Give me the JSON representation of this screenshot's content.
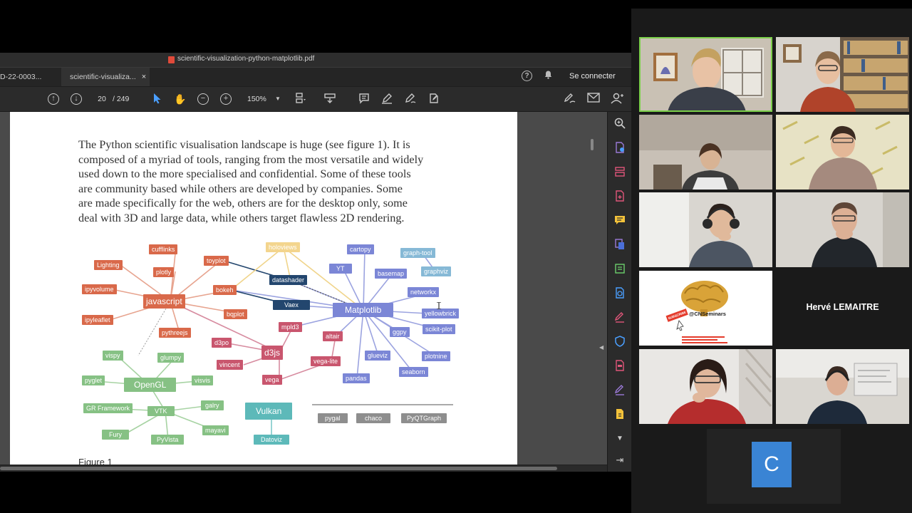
{
  "acrobat": {
    "window_title": "scientific-visualization-python-matplotlib.pdf",
    "tabs": [
      {
        "label": "D-22-0003..."
      },
      {
        "label": "scientific-visualiza..."
      }
    ],
    "connect_label": "Se connecter",
    "page_current": "20",
    "page_total": "/ 249",
    "zoom_level": "150%"
  },
  "document": {
    "paragraph_lines": [
      "The Python scientific visualisation landscape is huge (see figure 1).  It is",
      "composed of a myriad of tools, ranging from the most versatile and widely",
      "used down to the more specialised and confidential. Some of these tools",
      "are community based while others are developed by companies.  Some",
      "are made specifically for the web, others are for the desktop only, some",
      "deal with 3D and large data, while others target flawless 2D rendering."
    ],
    "figure_caption": "Figure 1",
    "graph_nodes": {
      "matplotlib": "Matplotlib",
      "javascript": "javascript",
      "d3js": "d3js",
      "opengl": "OpenGL",
      "vulkan": "Vulkan",
      "cufflinks": "cufflinks",
      "toyplot": "toyplot",
      "lighting": "Lighting",
      "plotly": "plotly",
      "ipyvolume": "ipyvolume",
      "bokeh": "bokeh",
      "ipyleaflet": "ipyleaflet",
      "bqplot": "bqplot",
      "pythreejs": "pythreejs",
      "d3po": "d3po",
      "mpld3": "mpld3",
      "vincent": "vincent",
      "vega": "vega",
      "vegalite": "vega-lite",
      "altair": "altair",
      "holoviews": "holoviews",
      "datashader": "datashader",
      "vaex": "Vaex",
      "cartopy": "cartopy",
      "yt": "YT",
      "basemap": "basemap",
      "graphtool": "graph-tool",
      "graphviz": "graphviz",
      "networkx": "networkx",
      "yellowbrick": "yellowbrick",
      "ggpy": "ggpy",
      "scikitplot": "scikit-plot",
      "glueviz": "glueviz",
      "plotnine": "plotnine",
      "pandas": "pandas",
      "seaborn": "seaborn",
      "vispy": "vispy",
      "glumpy": "glumpy",
      "pyglet": "pyglet",
      "visvis": "visvis",
      "grframework": "GR Framework",
      "galry": "galry",
      "vtk": "VTK",
      "mayavi": "mayavi",
      "fury": "Fury",
      "pyvista": "PyVista",
      "datoviz": "Datoviz",
      "pygal": "pygal",
      "chaco": "chaco",
      "pyqtgraph": "PyQTGraph"
    }
  },
  "gallery": {
    "participant_name_tile": "Hervé LEMAITRE",
    "avatar_letter": "C",
    "seminar_handle": "@CNSeminars",
    "subscribe_label": "SUBSCRIBE"
  },
  "colors": {
    "active_speaker_border": "#7bcf4a",
    "avatar_bg": "#3a84d4",
    "js_orange": "#d9694a",
    "mpl_blue": "#7b86d6",
    "d3_red": "#c9566e",
    "gl_green": "#86c184",
    "vulkan_teal": "#5db9b9",
    "gray_node": "#8e8e8e"
  }
}
